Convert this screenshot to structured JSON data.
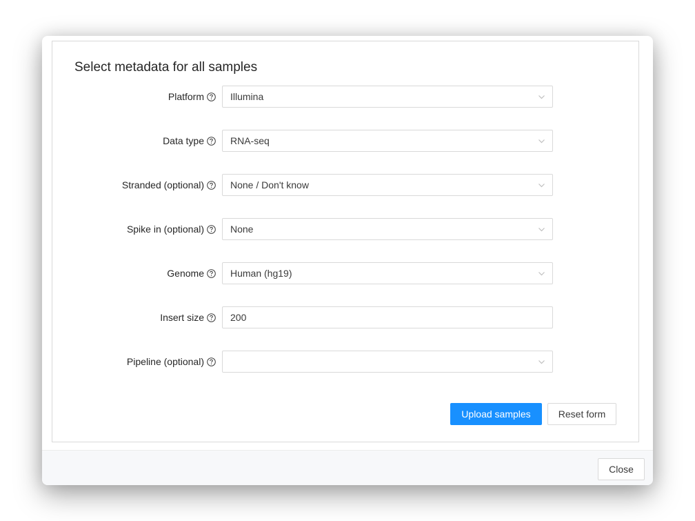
{
  "form": {
    "title": "Select metadata for all samples",
    "fields": [
      {
        "label": "Platform",
        "value": "Illumina",
        "type": "select"
      },
      {
        "label": "Data type",
        "value": "RNA-seq",
        "type": "select"
      },
      {
        "label": "Stranded (optional)",
        "value": "None / Don't know",
        "type": "select"
      },
      {
        "label": "Spike in (optional)",
        "value": "None",
        "type": "select"
      },
      {
        "label": "Genome",
        "value": "Human (hg19)",
        "type": "select"
      },
      {
        "label": "Insert size",
        "value": "200",
        "type": "input"
      },
      {
        "label": "Pipeline (optional)",
        "value": "",
        "type": "select"
      }
    ],
    "buttons": {
      "upload": "Upload samples",
      "reset": "Reset form"
    }
  },
  "footer": {
    "close": "Close"
  },
  "icons": {
    "help": "question-circle-icon",
    "dropdown": "chevron-down-icon"
  },
  "colors": {
    "primary": "#1890ff",
    "border": "#d9d9d9",
    "footer_bg": "#f7f8fa"
  }
}
